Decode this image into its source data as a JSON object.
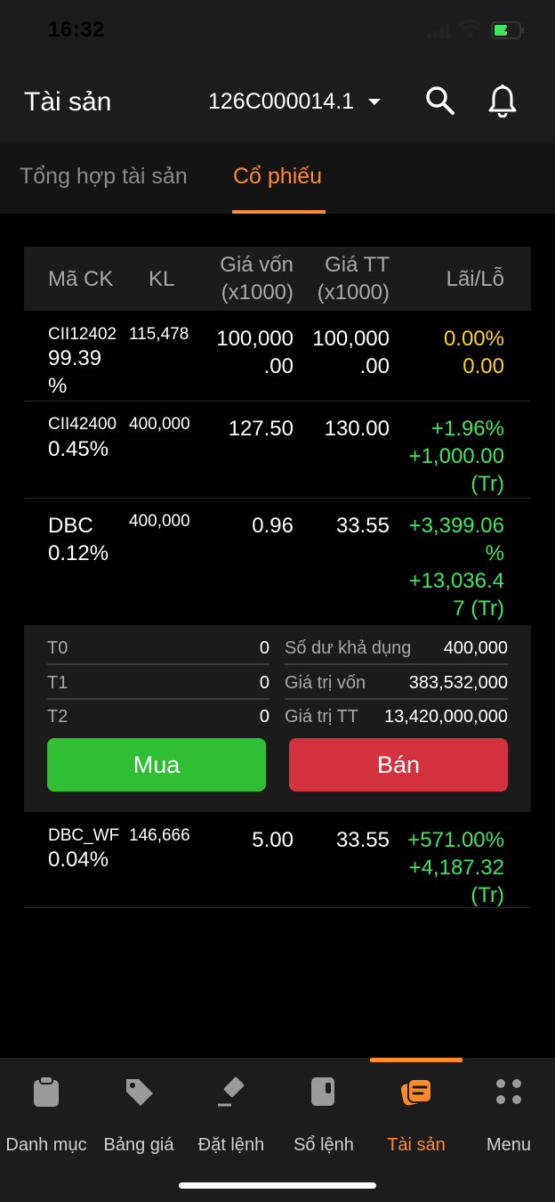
{
  "status": {
    "time": "16:32"
  },
  "header": {
    "title": "Tài sản",
    "account": "126C000014.1"
  },
  "tabs": [
    {
      "label": "Tổng hợp tài sản",
      "active": false
    },
    {
      "label": "Cổ phiếu",
      "active": true
    }
  ],
  "table": {
    "headers": {
      "code": "Mã CK",
      "kl": "KL",
      "cost_l1": "Giá vốn",
      "cost_l2": "(x1000)",
      "market_l1": "Giá TT",
      "market_l2": "(x1000)",
      "pl": "Lãi/Lỗ"
    },
    "rows": [
      {
        "code": "CII12402",
        "code_l2": "99.39",
        "code_l3": "%",
        "kl": "115,478",
        "cost_l1": "100,000",
        "cost_l2": ".00",
        "market_l1": "100,000",
        "market_l2": ".00",
        "pl_l1": "0.00%",
        "pl_l2": "0.00",
        "pl_color": "#ffd21f"
      },
      {
        "code": "CII42400",
        "code_l2": "0.45%",
        "kl": "400,000",
        "cost": "127.50",
        "market": "130.00",
        "pl_l1": "+1.96%",
        "pl_l2": "+1,000.00",
        "pl_l3": "(Tr)",
        "pl_color": "#3ee45b"
      },
      {
        "code": "DBC",
        "code_l2": "0.12%",
        "kl": "400,000",
        "cost": "0.96",
        "market": "33.55",
        "pl_l1": "+3,399.06",
        "pl_l2": "%",
        "pl_l3": "+13,036.4",
        "pl_l4": "7 (Tr)",
        "pl_color": "#3ee45b"
      },
      {
        "code": "DBC_WF",
        "code_l2": "0.04%",
        "kl": "146,666",
        "cost": "5.00",
        "market": "33.55",
        "pl_l1": "+571.00%",
        "pl_l2": "+4,187.32",
        "pl_l3": "(Tr)",
        "pl_color": "#3ee45b"
      }
    ]
  },
  "detail": {
    "t0_label": "T0",
    "t0_value": "0",
    "t1_label": "T1",
    "t1_value": "0",
    "t2_label": "T2",
    "t2_value": "0",
    "available_label": "Số dư khả dụng",
    "available_value": "400,000",
    "cost_value_label": "Giá trị vốn",
    "cost_value": "383,532,000",
    "market_value_label": "Giá trị TT",
    "market_value": "13,420,000,000",
    "buy_label": "Mua",
    "sell_label": "Bán"
  },
  "nav": [
    {
      "label": "Danh mục",
      "icon": "clipboard-icon"
    },
    {
      "label": "Bảng giá",
      "icon": "price-tag-icon"
    },
    {
      "label": "Đặt lệnh",
      "icon": "gavel-icon"
    },
    {
      "label": "Sổ lệnh",
      "icon": "order-book-icon"
    },
    {
      "label": "Tài sản",
      "icon": "wallet-icon",
      "active": true
    },
    {
      "label": "Menu",
      "icon": "grid-icon"
    }
  ],
  "colors": {
    "accent": "#ff8a2b",
    "buy": "#2fbe34",
    "sell": "#d3323e",
    "gain": "#3ee45b",
    "neutral": "#ffd21f"
  }
}
